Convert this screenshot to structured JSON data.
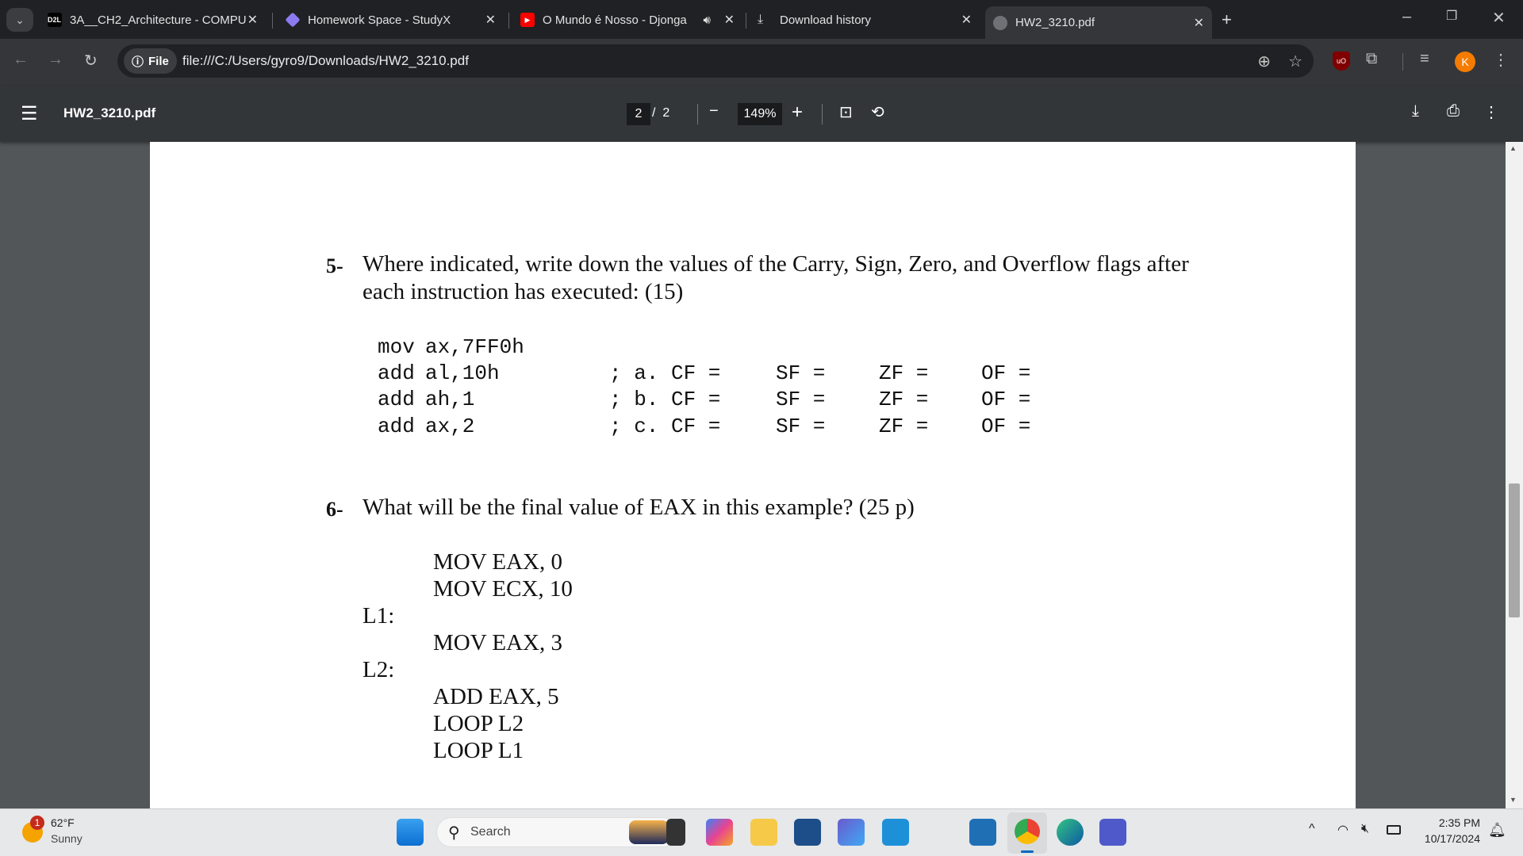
{
  "browser": {
    "tabs": [
      {
        "label": "3A__CH2_Architecture - COMPU",
        "favicon": "d2l-icon"
      },
      {
        "label": "Homework Space - StudyX",
        "favicon": "studyx-icon"
      },
      {
        "label": "O Mundo é Nosso - Djonga",
        "favicon": "youtube-icon",
        "audio": true
      },
      {
        "label": "Download history",
        "favicon": "download-icon"
      },
      {
        "label": "HW2_3210.pdf",
        "favicon": "globe-icon",
        "active": true
      }
    ],
    "chip_label": "File",
    "url": "file:///C:/Users/gyro9/Downloads/HW2_3210.pdf",
    "profile_initial": "K"
  },
  "pdf": {
    "title": "HW2_3210.pdf",
    "page_current": "2",
    "page_total": "2",
    "page_sep": "/",
    "zoom": "149%"
  },
  "doc": {
    "q5": {
      "num": "5-",
      "line1": "Where indicated, write down the values of the Carry, Sign, Zero, and Overflow flags after",
      "line2": "each instruction has executed: (15)",
      "code": [
        {
          "instr": "mov",
          "args": "ax,7FF0h",
          "comment": ""
        },
        {
          "instr": "add",
          "args": "al,10h",
          "comment": "; a.",
          "cf": "CF =",
          "sf": "SF =",
          "zf": "ZF =",
          "of": "OF ="
        },
        {
          "instr": "add",
          "args": "ah,1",
          "comment": "; b.",
          "cf": "CF =",
          "sf": "SF =",
          "zf": "ZF =",
          "of": "OF ="
        },
        {
          "instr": "add",
          "args": "ax,2",
          "comment": "; c.",
          "cf": "CF =",
          "sf": "SF =",
          "zf": "ZF =",
          "of": "OF ="
        }
      ]
    },
    "q6": {
      "num": "6-",
      "text": "What will be the final value of EAX in this example? (25 p)",
      "lines": [
        "MOV EAX, 0",
        "MOV ECX, 10",
        "L1:",
        "MOV EAX, 3",
        "L2:",
        "ADD EAX, 5",
        "LOOP L2",
        "LOOP L1"
      ]
    }
  },
  "taskbar": {
    "weather_temp": "62°F",
    "weather_desc": "Sunny",
    "weather_badge": "1",
    "search_placeholder": "Search",
    "time": "2:35 PM",
    "date": "10/17/2024"
  },
  "colors": {
    "accent_profile": "#f57c00",
    "youtube": "#ff0000",
    "page_bg": "#525659"
  }
}
